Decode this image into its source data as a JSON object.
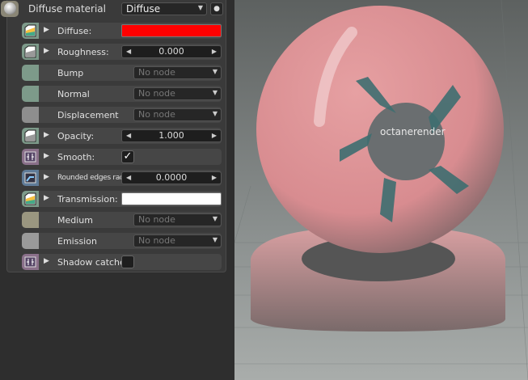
{
  "header": {
    "title": "Diffuse material",
    "type_value": "Diffuse",
    "visibility_icon": "eye-icon"
  },
  "rows": [
    {
      "label": "Diffuse:",
      "kind": "color",
      "value": "#ff0000",
      "swatch": "#7d9a8a",
      "icon": "texture-rgb-icon"
    },
    {
      "label": "Roughness:",
      "kind": "number",
      "value": "0.000",
      "swatch": "#7d9a8a",
      "icon": "texture-grey-icon"
    },
    {
      "label": "Bump",
      "kind": "node",
      "value": "No node",
      "swatch": "#7d9a8a"
    },
    {
      "label": "Normal",
      "kind": "node",
      "value": "No node",
      "swatch": "#7d9a8a"
    },
    {
      "label": "Displacement",
      "kind": "node",
      "value": "No node",
      "swatch": "#8e8e8e"
    },
    {
      "label": "Opacity:",
      "kind": "number",
      "value": "1.000",
      "swatch": "#7d9a8a",
      "icon": "texture-grey-icon"
    },
    {
      "label": "Smooth:",
      "kind": "check",
      "value": "✓",
      "checked": true,
      "swatch": "#8a708a",
      "icon": "bool-icon"
    },
    {
      "label": "Rounded edges radius:",
      "kind": "number",
      "value": "0.0000",
      "swatch": "#5f7b98",
      "icon": "float-icon"
    },
    {
      "label": "Transmission:",
      "kind": "color",
      "value": "#ffffff",
      "swatch": "#7d9a8a",
      "icon": "texture-rgb-icon"
    },
    {
      "label": "Medium",
      "kind": "node",
      "value": "No node",
      "swatch": "#9a9680"
    },
    {
      "label": "Emission",
      "kind": "node",
      "value": "No node",
      "swatch": "#9a9a9a"
    },
    {
      "label": "Shadow catcher:",
      "kind": "check",
      "value": "",
      "checked": false,
      "swatch": "#8a708a",
      "icon": "bool-icon"
    }
  ],
  "render": {
    "logo_text": "octanerender"
  }
}
